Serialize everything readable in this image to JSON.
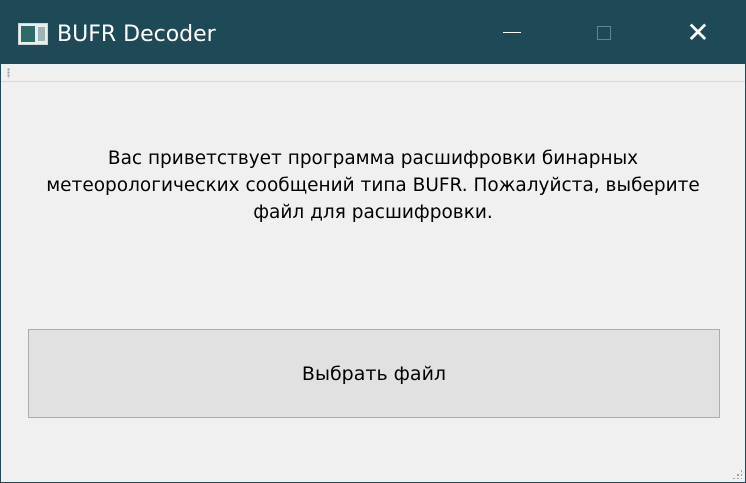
{
  "window": {
    "title": "BUFR Decoder",
    "colors": {
      "titlebar": "#1e4a58",
      "background": "#f0f0f0",
      "button": "#e1e1e1"
    }
  },
  "controls": {
    "minimize_icon": "minimize-icon",
    "maximize_icon": "maximize-icon",
    "close_icon": "close-icon",
    "close_glyph": "✕"
  },
  "main": {
    "welcome_text": "Вас приветствует программа расшифровки бинарных метеорологических сообщений типа BUFR. Пожалуйста, выберите файл для расшифровки.",
    "choose_button_label": "Выбрать файл"
  }
}
